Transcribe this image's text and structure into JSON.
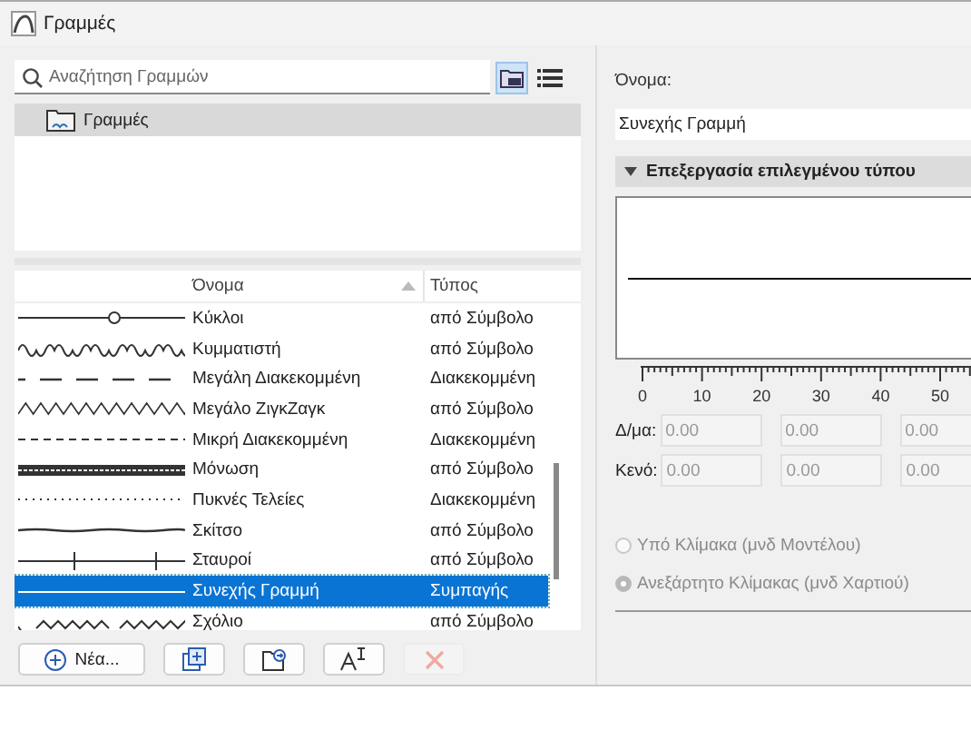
{
  "window": {
    "title": "Γραμμές"
  },
  "search": {
    "placeholder": "Αναζήτηση Γραμμών"
  },
  "view_toggles": [
    {
      "kind": "folder",
      "selected": true
    },
    {
      "kind": "list",
      "selected": false
    }
  ],
  "tree": {
    "items": [
      {
        "label": "Γραμμές",
        "selected": true
      }
    ]
  },
  "table": {
    "columns": [
      {
        "label": "Όνομα",
        "sorted": true
      },
      {
        "label": "Τύπος",
        "sorted": false
      }
    ],
    "rows": [
      {
        "kind": "circles",
        "name": "Κύκλοι",
        "type": "από Σύμβολο",
        "selected": false
      },
      {
        "kind": "wave",
        "name": "Κυμματιστή",
        "type": "από Σύμβολο",
        "selected": false
      },
      {
        "kind": "long-dash",
        "name": "Μεγάλη Διακεκομμένη",
        "type": "Διακεκομμένη",
        "selected": false
      },
      {
        "kind": "zigzag",
        "name": "Μεγάλο ΖιγκΖαγκ",
        "type": "από Σύμβολο",
        "selected": false
      },
      {
        "kind": "short-dash",
        "name": "Μικρή Διακεκομμένη",
        "type": "Διακεκομμένη",
        "selected": false
      },
      {
        "kind": "insulation",
        "name": "Μόνωση",
        "type": "από Σύμβολο",
        "selected": false
      },
      {
        "kind": "dots",
        "name": "Πυκνές Τελείες",
        "type": "Διακεκομμένη",
        "selected": false
      },
      {
        "kind": "sketch",
        "name": "Σκίτσο",
        "type": "από Σύμβολο",
        "selected": false
      },
      {
        "kind": "crosses",
        "name": "Σταυροί",
        "type": "από Σύμβολο",
        "selected": false
      },
      {
        "kind": "solid",
        "name": "Συνεχής Γραμμή",
        "type": "Συμπαγής",
        "selected": true
      },
      {
        "kind": "comment",
        "name": "Σχόλιο",
        "type": "από Σύμβολο",
        "selected": false
      }
    ]
  },
  "buttons": [
    {
      "kind": "new",
      "label": "Νέα...",
      "disabled": false
    },
    {
      "kind": "duplicate",
      "disabled": false
    },
    {
      "kind": "import",
      "disabled": false
    },
    {
      "kind": "rename",
      "disabled": false
    },
    {
      "kind": "delete",
      "disabled": true
    }
  ],
  "name_field": {
    "label": "Όνομα:",
    "value": "Συνεχής Γραμμή"
  },
  "section": {
    "title": "Επεξεργασία επιλεγμένου τύπου",
    "expanded": true
  },
  "ruler": {
    "labels": [
      "0",
      "10",
      "20",
      "30",
      "40",
      "50"
    ]
  },
  "dash_rows": [
    {
      "label": "Δ/μα:",
      "values": [
        "0.00",
        "0.00",
        "0.00"
      ]
    },
    {
      "label": "Κενό:",
      "values": [
        "0.00",
        "0.00",
        "0.00"
      ]
    }
  ],
  "scale_options": [
    {
      "label": "Υπό Κλίμακα (μνδ Μοντέλου)",
      "selected": false,
      "disabled": true
    },
    {
      "label": "Ανεξάρτητο Κλίμακας (μνδ Χαρτιού)",
      "selected": true,
      "disabled": true
    }
  ]
}
